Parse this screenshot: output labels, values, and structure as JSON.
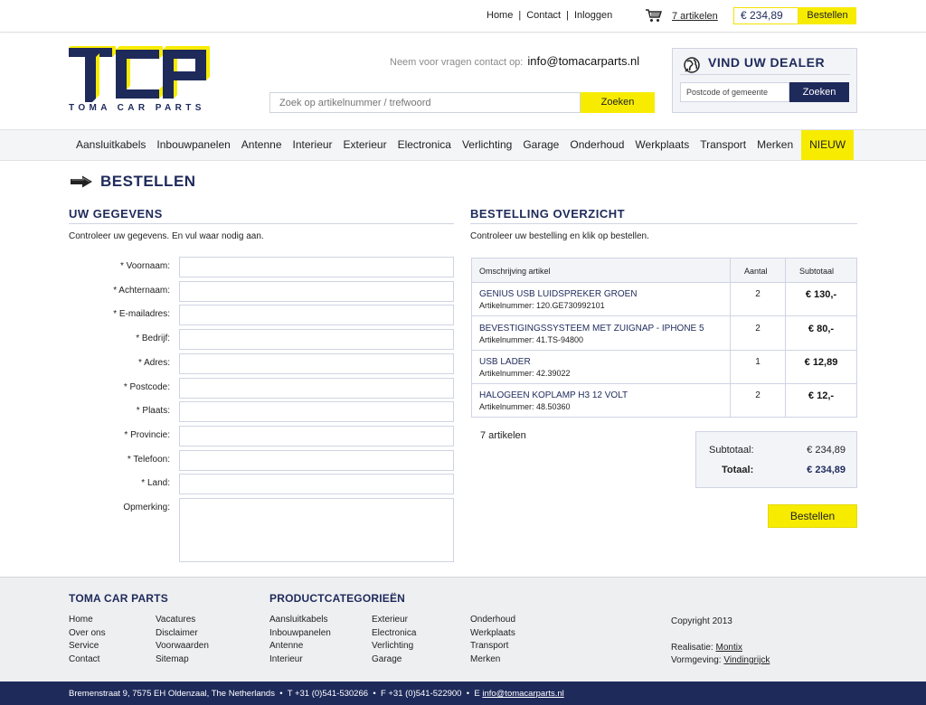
{
  "topbar": {
    "links": [
      "Home",
      "Contact",
      "Inloggen"
    ],
    "cart_count": "7 artikelen",
    "cart_total": "€ 234,89",
    "order_label": "Bestellen"
  },
  "header": {
    "logo_subtitle": "TOMA CAR PARTS",
    "contact_prefix": "Neem voor vragen contact op:",
    "contact_email": "info@tomacarparts.nl",
    "search_placeholder": "Zoek op artikelnummer / trefwoord",
    "search_button": "Zoeken",
    "dealer_title": "VIND UW DEALER",
    "dealer_placeholder": "Postcode of gemeente",
    "dealer_button": "Zoeken"
  },
  "nav": {
    "items": [
      "Aansluitkabels",
      "Inbouwpanelen",
      "Antenne",
      "Interieur",
      "Exterieur",
      "Electronica",
      "Verlichting",
      "Garage",
      "Onderhoud",
      "Werkplaats",
      "Transport",
      "Merken"
    ],
    "new_label": "NIEUW"
  },
  "page": {
    "title": "BESTELLEN"
  },
  "details": {
    "heading": "UW GEGEVENS",
    "intro": "Controleer uw gegevens. En vul waar nodig aan.",
    "fields": [
      "* Voornaam:",
      "* Achternaam:",
      "* E-mailadres:",
      "* Bedrijf:",
      "* Adres:",
      "* Postcode:",
      "* Plaats:",
      "* Provincie:",
      "* Telefoon:",
      "* Land:"
    ],
    "remark_label": "Opmerking:"
  },
  "overview": {
    "heading": "BESTELLING OVERZICHT",
    "intro": "Controleer uw bestelling en klik op bestellen.",
    "col_description": "Omschrijving artikel",
    "col_qty": "Aantal",
    "col_subtotal": "Subtotaal",
    "rows": [
      {
        "name": "GENIUS USB LUIDSPREKER GROEN",
        "sku": "Artikelnummer: 120.GE730992101",
        "qty": "2",
        "subtotal": "€ 130,-"
      },
      {
        "name": "BEVESTIGINGSSYSTEEM MET ZUIGNAP - IPHONE 5",
        "sku": "Artikelnummer: 41.TS-94800",
        "qty": "2",
        "subtotal": "€ 80,-"
      },
      {
        "name": "USB LADER",
        "sku": "Artikelnummer: 42.39022",
        "qty": "1",
        "subtotal": "€ 12,89"
      },
      {
        "name": "HALOGEEN KOPLAMP H3 12 VOLT",
        "sku": "Artikelnummer: 48.50360",
        "qty": "2",
        "subtotal": "€ 12,-"
      }
    ],
    "item_count": "7 artikelen",
    "subtotal_label": "Subtotaal:",
    "subtotal_value": "€ 234,89",
    "total_label": "Totaal:",
    "total_value": "€ 234,89",
    "order_button": "Bestellen"
  },
  "footer": {
    "brand_heading": "TOMA CAR PARTS",
    "col1": [
      "Home",
      "Over ons",
      "Service",
      "Contact"
    ],
    "col2": [
      "Vacatures",
      "Disclaimer",
      "Voorwaarden",
      "Sitemap"
    ],
    "categories_heading": "PRODUCTCATEGORIEËN",
    "cat1": [
      "Aansluitkabels",
      "Inbouwpanelen",
      "Antenne",
      "Interieur"
    ],
    "cat2": [
      "Exterieur",
      "Electronica",
      "Verlichting",
      "Garage"
    ],
    "cat3": [
      "Onderhoud",
      "Werkplaats",
      "Transport",
      "Merken"
    ],
    "copyright": "Copyright 2013",
    "realisatie_label": "Realisatie:",
    "realisatie_link": "Montix",
    "vormgeving_label": "Vormgeving:",
    "vormgeving_link": "Vindingrijck"
  },
  "bottombar": {
    "address": "Bremenstraat 9, 7575 EH  Oldenzaal, The Netherlands",
    "phone": "T +31 (0)541-530266",
    "fax": "F +31 (0)541-522900",
    "email_prefix": "E",
    "email": "info@tomacarparts.nl"
  },
  "colors": {
    "navy": "#1e2a5a",
    "yellow": "#f7ec00"
  }
}
